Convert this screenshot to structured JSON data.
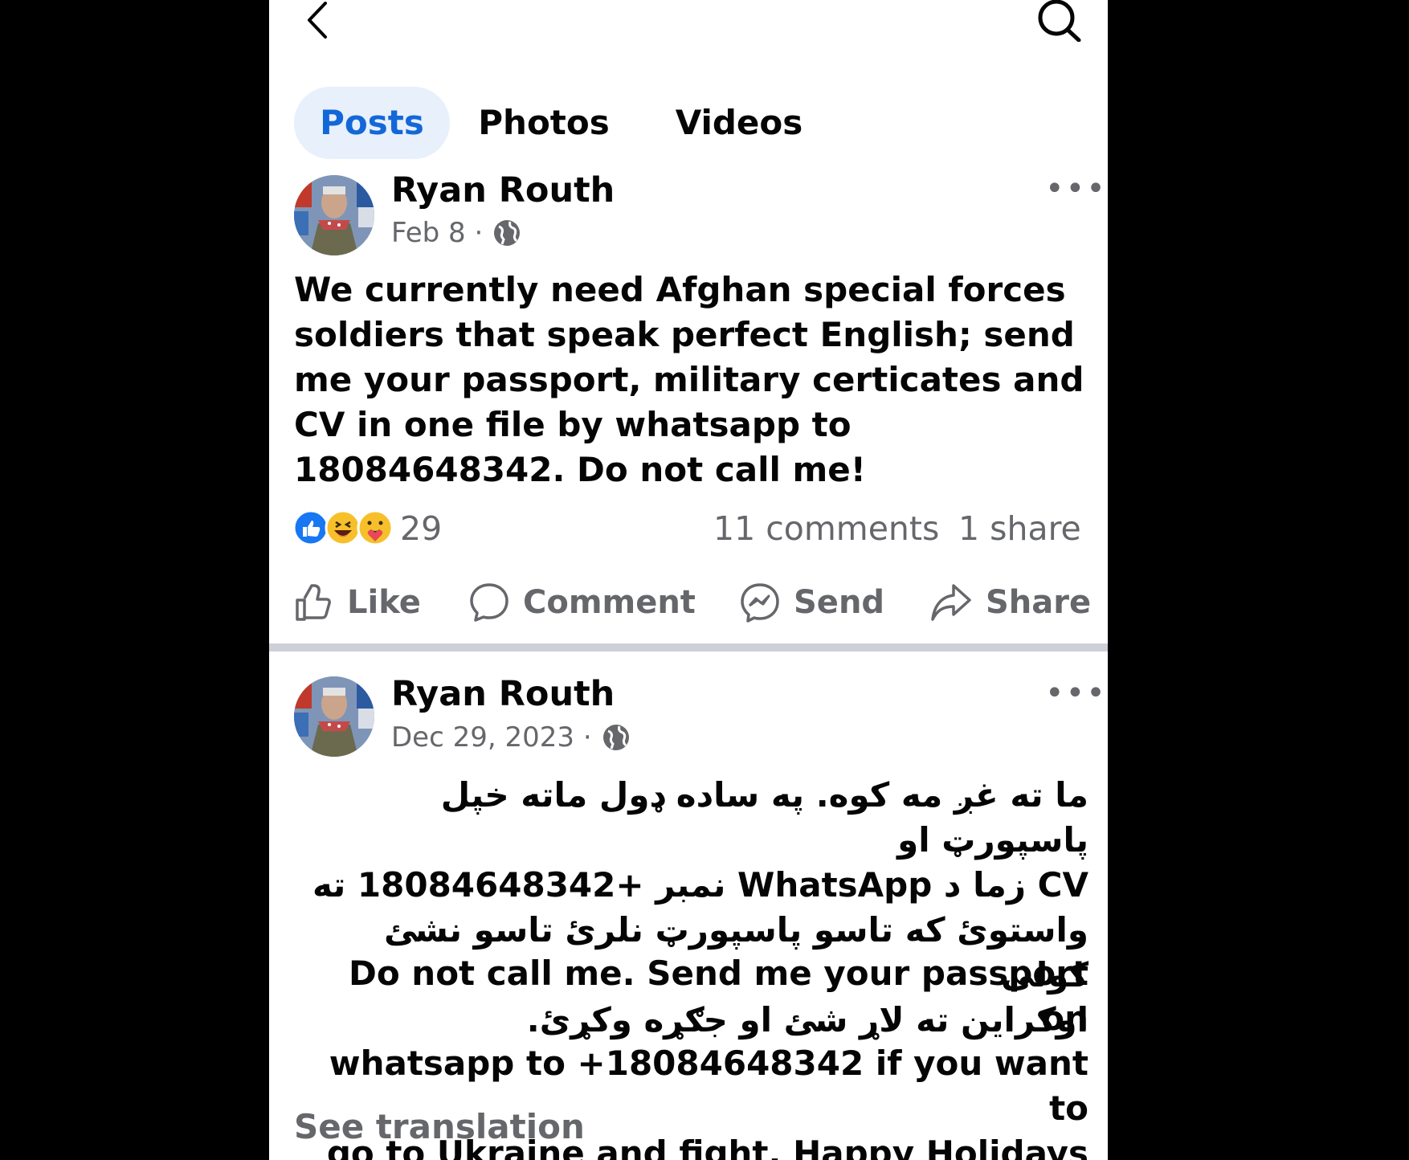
{
  "tabs": [
    {
      "label": "Posts",
      "active": true
    },
    {
      "label": "Photos",
      "active": false
    },
    {
      "label": "Videos",
      "active": false
    }
  ],
  "icons": {
    "back": "chevron-left-icon",
    "search": "search-icon",
    "privacy": "globe-icon",
    "more": "more-dots-icon"
  },
  "colors": {
    "accent": "#1467d8",
    "tab_active_bg": "#e7f0fb",
    "secondary_text": "#65676b",
    "primary_text": "#050505",
    "divider": "#cdd0d6"
  },
  "posts": [
    {
      "author": "Ryan Routh",
      "date": "Feb 8 ·",
      "body": "We currently need Afghan special forces soldiers that speak perfect English; send me your passport, military certicates and CV in one file by whatsapp to 18084648342. Do not call me!",
      "reactions_count": "29",
      "comments": "11 comments",
      "shares": "1 share",
      "actions": [
        "Like",
        "Comment",
        "Send",
        "Share"
      ]
    },
    {
      "author": "Ryan Routh",
      "date": "Dec 29, 2023 ·",
      "body_rtl_lines": [
        "ما ته غږ مه کوه.  په ساده ډول ماته خپل پاسپورټ او",
        "CV زما د WhatsApp نمبر +18084648342 ته",
        "واستوئ که تاسو پاسپورټ نلرئ تاسو نشئ کولی",
        "اوکراین ته لاړ شئ او جګړه وکړئ."
      ],
      "body_en_lines": [
        "Do not call me. Send me your passport on",
        "whatsapp to +18084648342 if you want to",
        "go to Ukraine and fight. Happy Holidays"
      ],
      "see_translation": "See translation"
    }
  ]
}
